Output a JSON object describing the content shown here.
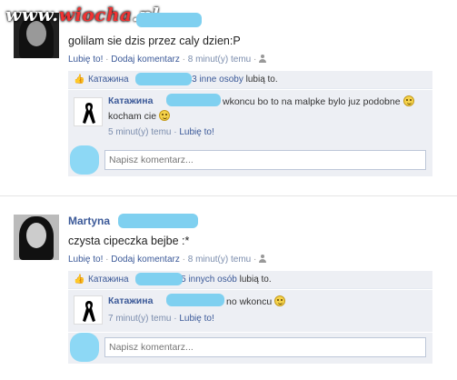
{
  "watermark": {
    "prefix": "www.",
    "brand": "wiocha",
    "suffix": ".pl"
  },
  "posts": [
    {
      "author": "",
      "text": "golilam sie dzis przez caly dzien:P",
      "actions": {
        "like": "Lubię to!",
        "comment": "Dodaj komentarz",
        "time": "8 minut(y) temu"
      },
      "likes": {
        "name": "Катажина",
        "rest": "3 inne osoby",
        "tail": "lubią to."
      },
      "comment": {
        "author": "Катажина",
        "text": "wkoncu bo to na malpke bylo juz podobne",
        "text2": "kocham cie",
        "time": "5 minut(y) temu",
        "like": "Lubię to!"
      },
      "input_placeholder": "Napisz komentarz..."
    },
    {
      "author": "Martyna",
      "text": "czysta cipeczka bejbe :*",
      "actions": {
        "like": "Lubię to!",
        "comment": "Dodaj komentarz",
        "time": "8 minut(y) temu"
      },
      "likes": {
        "name": "Катажина",
        "rest": "5 innych osób",
        "tail": "lubią to."
      },
      "comment": {
        "author": "Катажина",
        "text": "no wkoncu",
        "time": "7 minut(y) temu",
        "like": "Lubię to!"
      },
      "input_placeholder": "Napisz komentarz..."
    }
  ],
  "icons": {
    "like": "thumbs-up-icon",
    "audience": "friends-icon",
    "mourning": "black-ribbon-icon",
    "emoticon": "smiley-icon"
  },
  "colors": {
    "link": "#3b5998",
    "box": "#edeff4",
    "censor": "#7fd0f0"
  }
}
